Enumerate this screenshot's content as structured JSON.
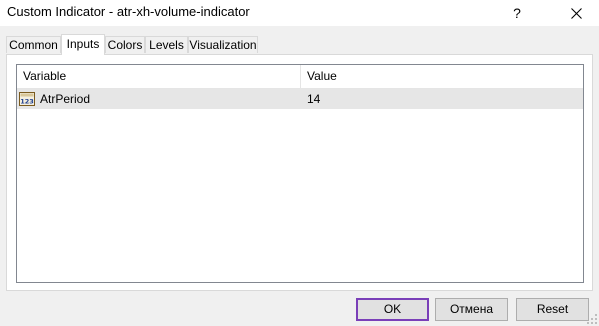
{
  "window": {
    "title": "Custom Indicator - atr-xh-volume-indicator",
    "help_glyph": "?",
    "close_icon": "close-icon"
  },
  "tabs": [
    {
      "label": "Common",
      "active": false
    },
    {
      "label": "Inputs",
      "active": true
    },
    {
      "label": "Colors",
      "active": false
    },
    {
      "label": "Levels",
      "active": false
    },
    {
      "label": "Visualization",
      "active": false
    }
  ],
  "inputs_table": {
    "columns": [
      "Variable",
      "Value"
    ],
    "rows": [
      {
        "icon": "integer-type-icon",
        "icon_text": "123",
        "variable": "AtrPeriod",
        "value": "14",
        "selected": true
      }
    ]
  },
  "buttons": {
    "ok": "OK",
    "cancel": "Отмена",
    "reset": "Reset"
  },
  "colors": {
    "accent_focus": "#7a3fb8",
    "selected_row": "#e6e6e6",
    "dialog_bg": "#f0f0f0"
  }
}
